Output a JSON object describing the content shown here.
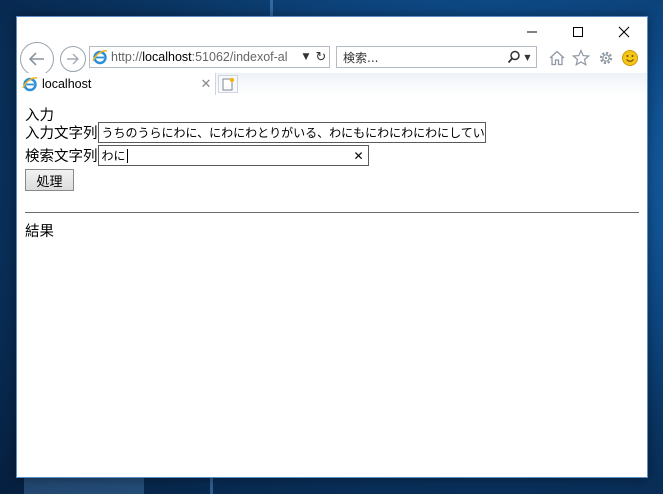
{
  "browser": {
    "address": {
      "prefix": "http://",
      "host": "localhost",
      "rest": ":51062/indexof-al"
    },
    "search_placeholder": "検索...",
    "tab_title": "localhost"
  },
  "page": {
    "section_input": "入力",
    "input_label": "入力文字列",
    "input_value": "うちのうらにわに、にわにわとりがいる、わにもにわにわにわにしている",
    "search_label": "検索文字列",
    "search_value": "わに",
    "process_button": "処理",
    "result_heading": "結果"
  },
  "icons": {
    "back": "back-arrow-icon",
    "forward": "forward-arrow-icon",
    "home": "home-icon",
    "favorites": "star-icon",
    "tools": "gear-icon",
    "feedback": "smiley-icon"
  },
  "colors": {
    "desktop": "#0f4f8f",
    "window_border": "#5d8fc4",
    "field_border": "#5a5a5a"
  }
}
